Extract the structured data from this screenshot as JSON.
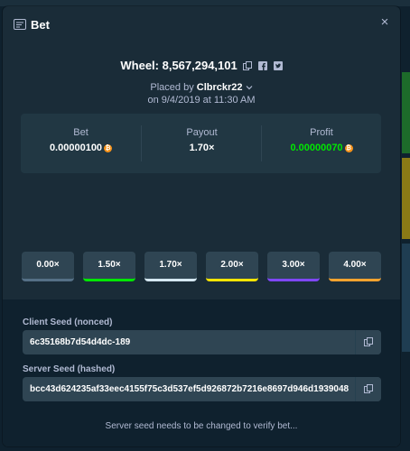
{
  "modal": {
    "title": "Bet",
    "close": "×"
  },
  "game": {
    "label": "Wheel: 8,567,294,101",
    "placed_by_prefix": "Placed by",
    "user": "Clbrckr22",
    "date": "on 9/4/2019 at 11:30 AM"
  },
  "stats": {
    "bet_label": "Bet",
    "bet_value": "0.00000100",
    "payout_label": "Payout",
    "payout_value": "1.70×",
    "profit_label": "Profit",
    "profit_value": "0.00000070"
  },
  "multipliers": [
    {
      "label": "0.00×",
      "color": "#557086"
    },
    {
      "label": "1.50×",
      "color": "#00e701"
    },
    {
      "label": "1.70×",
      "color": "#d5e8f2"
    },
    {
      "label": "2.00×",
      "color": "#ffe500"
    },
    {
      "label": "3.00×",
      "color": "#7f47fd"
    },
    {
      "label": "4.00×",
      "color": "#fca32f"
    }
  ],
  "seeds": {
    "client_label": "Client Seed (nonced)",
    "client_value": "6c35168b7d54d4dc-189",
    "server_label": "Server Seed (hashed)",
    "server_value": "bcc43d624235af33eec4155f75c3d537ef5d926872b7216e8697d946d1939048",
    "note": "Server seed needs to be changed to verify bet..."
  },
  "colors": {
    "profit": "#00e701",
    "coin": "#f7931a",
    "accent": "#1a2c38"
  }
}
